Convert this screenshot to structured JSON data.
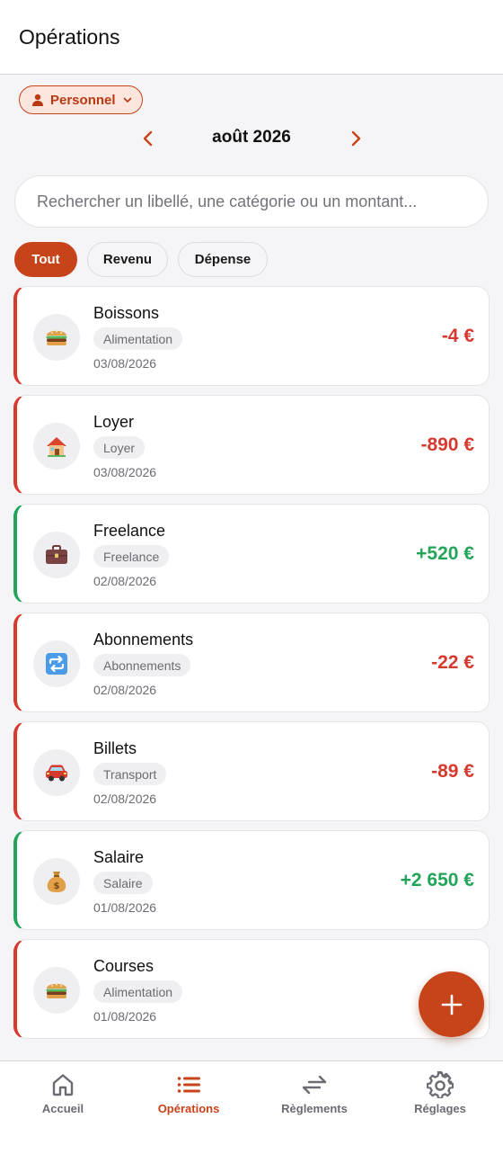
{
  "header": {
    "title": "Opérations"
  },
  "profile": {
    "label": "Personnel",
    "icon": "person-icon"
  },
  "month": {
    "label": "août 2026"
  },
  "search": {
    "placeholder": "Rechercher un libellé, une catégorie ou un montant..."
  },
  "filters": [
    {
      "label": "Tout",
      "active": true
    },
    {
      "label": "Revenu",
      "active": false
    },
    {
      "label": "Dépense",
      "active": false
    }
  ],
  "transactions": [
    {
      "name": "Boissons",
      "category": "Alimentation",
      "date": "03/08/2026",
      "amount": "-4 €",
      "kind": "expense",
      "icon": "burger-icon"
    },
    {
      "name": "Loyer",
      "category": "Loyer",
      "date": "03/08/2026",
      "amount": "-890 €",
      "kind": "expense",
      "icon": "house-icon"
    },
    {
      "name": "Freelance",
      "category": "Freelance",
      "date": "02/08/2026",
      "amount": "+520 €",
      "kind": "income",
      "icon": "briefcase-icon"
    },
    {
      "name": "Abonnements",
      "category": "Abonnements",
      "date": "02/08/2026",
      "amount": "-22 €",
      "kind": "expense",
      "icon": "repeat-icon"
    },
    {
      "name": "Billets",
      "category": "Transport",
      "date": "02/08/2026",
      "amount": "-89 €",
      "kind": "expense",
      "icon": "car-icon"
    },
    {
      "name": "Salaire",
      "category": "Salaire",
      "date": "01/08/2026",
      "amount": "+2 650 €",
      "kind": "income",
      "icon": "money-bag-icon"
    },
    {
      "name": "Courses",
      "category": "Alimentation",
      "date": "01/08/2026",
      "amount": "",
      "kind": "expense",
      "icon": "burger-icon"
    }
  ],
  "nav": [
    {
      "label": "Accueil",
      "icon": "home-icon",
      "active": false
    },
    {
      "label": "Opérations",
      "icon": "list-icon",
      "active": true
    },
    {
      "label": "Règlements",
      "icon": "transfer-icon",
      "active": false
    },
    {
      "label": "Réglages",
      "icon": "gear-icon",
      "active": false
    }
  ],
  "colors": {
    "accent": "#c7431a",
    "expense": "#d63a2f",
    "income": "#23a559"
  }
}
